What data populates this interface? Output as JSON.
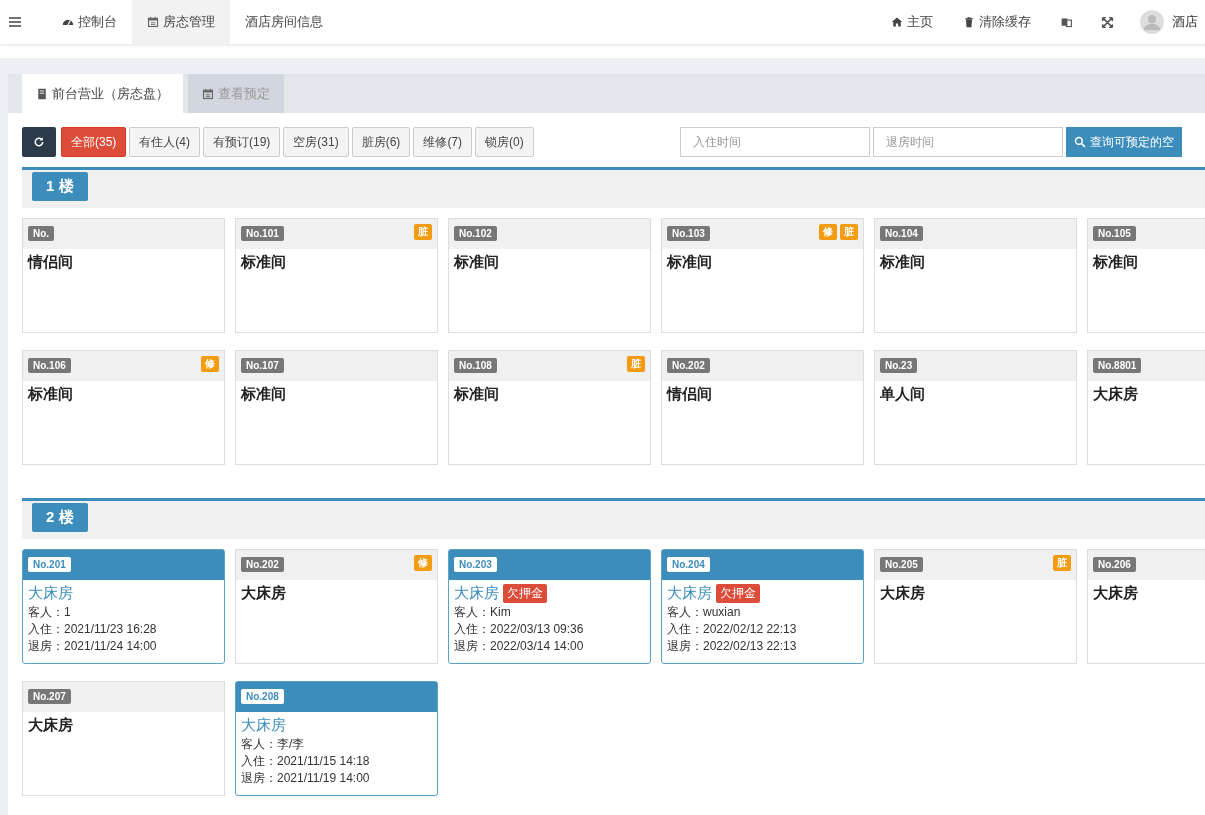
{
  "nav": {
    "items": [
      {
        "label": "控制台",
        "selected": false
      },
      {
        "label": "房态管理",
        "selected": true
      },
      {
        "label": "酒店房间信息",
        "selected": false
      }
    ],
    "right": [
      {
        "label": "主页"
      },
      {
        "label": "清除缓存"
      }
    ],
    "user": "酒店"
  },
  "tabs": [
    {
      "label": "前台营业（房态盘）",
      "selected": true
    },
    {
      "label": "查看预定",
      "selected": false
    }
  ],
  "filters": [
    {
      "label": "全部(35)",
      "selected": true
    },
    {
      "label": "有住人(4)",
      "selected": false
    },
    {
      "label": "有预订(19)",
      "selected": false
    },
    {
      "label": "空房(31)",
      "selected": false
    },
    {
      "label": "脏房(6)",
      "selected": false
    },
    {
      "label": "维修(7)",
      "selected": false
    },
    {
      "label": "锁房(0)",
      "selected": false
    }
  ],
  "checkin_field": {
    "placeholder": "入住时间"
  },
  "checkout_field": {
    "placeholder": "退房时间"
  },
  "search_button": "查询可预定的空",
  "floors": [
    {
      "label": "1 楼",
      "rooms": [
        {
          "number": "No.",
          "type": "情侣间",
          "occupied": false
        },
        {
          "number": "No.101",
          "type": "标准间",
          "occupied": false,
          "tags": [
            "脏"
          ]
        },
        {
          "number": "No.102",
          "type": "标准间",
          "occupied": false
        },
        {
          "number": "No.103",
          "type": "标准间",
          "occupied": false,
          "tags": [
            "修",
            "脏"
          ]
        },
        {
          "number": "No.104",
          "type": "标准间",
          "occupied": false
        },
        {
          "number": "No.105",
          "type": "标准间",
          "occupied": false
        },
        {
          "number": "No.106",
          "type": "标准间",
          "occupied": false,
          "tags": [
            "修"
          ]
        },
        {
          "number": "No.107",
          "type": "标准间",
          "occupied": false
        },
        {
          "number": "No.108",
          "type": "标准间",
          "occupied": false,
          "tags": [
            "脏"
          ]
        },
        {
          "number": "No.202",
          "type": "情侣间",
          "occupied": false
        },
        {
          "number": "No.23",
          "type": "单人间",
          "occupied": false
        },
        {
          "number": "No.8801",
          "type": "大床房",
          "occupied": false
        }
      ]
    },
    {
      "label": "2 楼",
      "rooms": [
        {
          "number": "No.201",
          "type": "大床房",
          "occupied": true,
          "guest": "客人：1",
          "checkin": "入住：2021/11/23 16:28",
          "checkout": "退房：2021/11/24 14:00"
        },
        {
          "number": "No.202",
          "type": "大床房",
          "occupied": false,
          "tags": [
            "修"
          ]
        },
        {
          "number": "No.203",
          "type": "大床房",
          "occupied": true,
          "warning": "欠押金",
          "guest": "客人：Kim",
          "checkin": "入住：2022/03/13 09:36",
          "checkout": "退房：2022/03/14 14:00"
        },
        {
          "number": "No.204",
          "type": "大床房",
          "occupied": true,
          "warning": "欠押金",
          "guest": "客人：wuxian",
          "checkin": "入住：2022/02/12 22:13",
          "checkout": "退房：2022/02/13 22:13"
        },
        {
          "number": "No.205",
          "type": "大床房",
          "occupied": false,
          "tags": [
            "脏"
          ]
        },
        {
          "number": "No.206",
          "type": "大床房",
          "occupied": false
        },
        {
          "number": "No.207",
          "type": "大床房",
          "occupied": false
        },
        {
          "number": "No.208",
          "type": "大床房",
          "occupied": true,
          "guest": "客人：李/李",
          "checkin": "入住：2021/11/15 14:18",
          "checkout": "退房：2021/11/19 14:00"
        }
      ]
    }
  ]
}
